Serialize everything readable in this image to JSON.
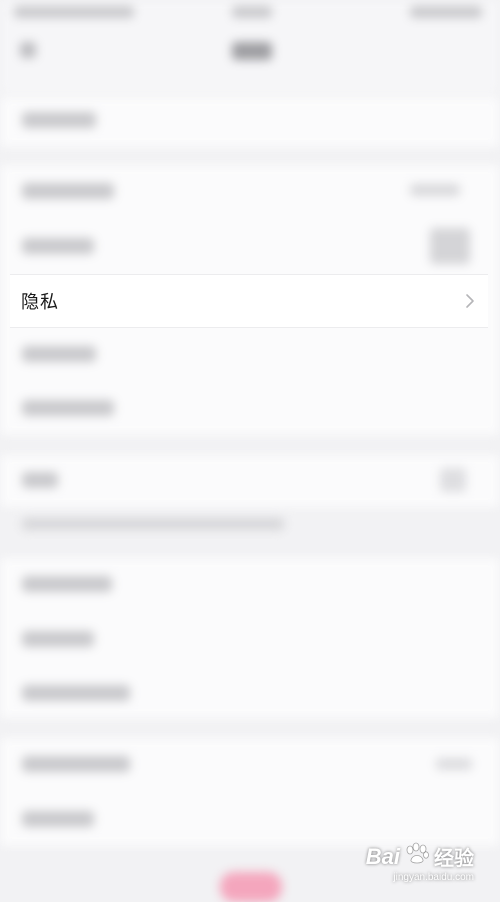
{
  "settings": {
    "privacy_label": "隐私",
    "privacy_chevron_icon": "chevron-right-icon"
  },
  "watermark": {
    "brand": "Bai",
    "paw_icon": "paw-icon",
    "brand_suffix": "经验",
    "url": "jingyan.baidu.com"
  },
  "colors": {
    "background": "#f2f2f4",
    "row_background": "#ffffff",
    "accent_pink": "#f4a6bd"
  }
}
